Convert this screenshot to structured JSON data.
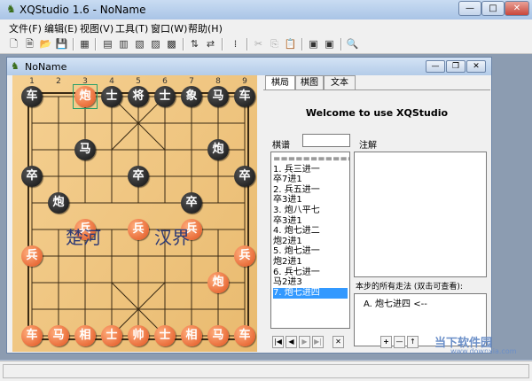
{
  "window": {
    "title": "XQStudio 1.6 - NoName",
    "icon": "chess-app-icon"
  },
  "menu": [
    "文件(F)",
    "编辑(E)",
    "视图(V)",
    "工具(T)",
    "窗口(W)",
    "帮助(H)"
  ],
  "toolbar": [
    "new-icon",
    "new-doc-icon",
    "open-icon",
    "save-icon",
    "board-icon",
    "import-icon",
    "export-icon",
    "flip-icon",
    "copy-board-icon",
    "paste-board-icon",
    "swap-vertical-icon",
    "swap-horizontal-icon",
    "analysis-icon",
    "cut-icon",
    "copy-icon",
    "paste-icon",
    "book-icon",
    "book2-icon",
    "preview-icon"
  ],
  "child": {
    "title": "NoName"
  },
  "board": {
    "files_top": [
      "1",
      "2",
      "3",
      "4",
      "5",
      "6",
      "7",
      "8",
      "9"
    ],
    "river_left": "楚河",
    "river_right": "汉界",
    "pieces": [
      {
        "c": "black",
        "t": "车"
      },
      {
        "c": "red",
        "t": "炮"
      },
      {
        "c": "black",
        "t": "士"
      },
      {
        "c": "black",
        "t": "将"
      },
      {
        "c": "black",
        "t": "士"
      },
      {
        "c": "black",
        "t": "象"
      },
      {
        "c": "black",
        "t": "马"
      },
      {
        "c": "black",
        "t": "车"
      },
      {
        "c": "black",
        "t": "马"
      },
      {
        "c": "black",
        "t": "炮"
      },
      {
        "c": "black",
        "t": "卒"
      },
      {
        "c": "black",
        "t": "卒"
      },
      {
        "c": "black",
        "t": "卒"
      },
      {
        "c": "black",
        "t": "炮"
      },
      {
        "c": "black",
        "t": "卒"
      },
      {
        "c": "red",
        "t": "兵"
      },
      {
        "c": "red",
        "t": "兵"
      },
      {
        "c": "red",
        "t": "兵"
      },
      {
        "c": "red",
        "t": "兵"
      },
      {
        "c": "red",
        "t": "兵"
      },
      {
        "c": "red",
        "t": "炮"
      },
      {
        "c": "red",
        "t": "车"
      },
      {
        "c": "red",
        "t": "马"
      },
      {
        "c": "red",
        "t": "相"
      },
      {
        "c": "red",
        "t": "士"
      },
      {
        "c": "red",
        "t": "帅"
      },
      {
        "c": "red",
        "t": "士"
      },
      {
        "c": "red",
        "t": "相"
      },
      {
        "c": "red",
        "t": "马"
      },
      {
        "c": "red",
        "t": "车"
      }
    ]
  },
  "tabs": [
    "棋局",
    "棋图",
    "文本"
  ],
  "welcome": "Welcome to use XQStudio",
  "record_label": "棋谱",
  "comment_label": "注解",
  "moves": [
    "===========",
    "1.  兵三进一",
    "    卒7进1",
    "2.  兵五进一",
    "    卒3进1",
    "3.  炮八平七",
    "    卒3进1",
    "4.  炮七进二",
    "    炮2进1",
    "5.  炮七进一",
    "    炮2进1",
    "6.  兵七进一",
    "    马2进3",
    "7.  炮七进四"
  ],
  "selected_move": 13,
  "variation_label": "本步的所有走法 (双击可查看):",
  "variations": [
    "A.  炮七进四 <--"
  ],
  "watermark": "当下软件园",
  "watermark_url": "www.downxia.com"
}
